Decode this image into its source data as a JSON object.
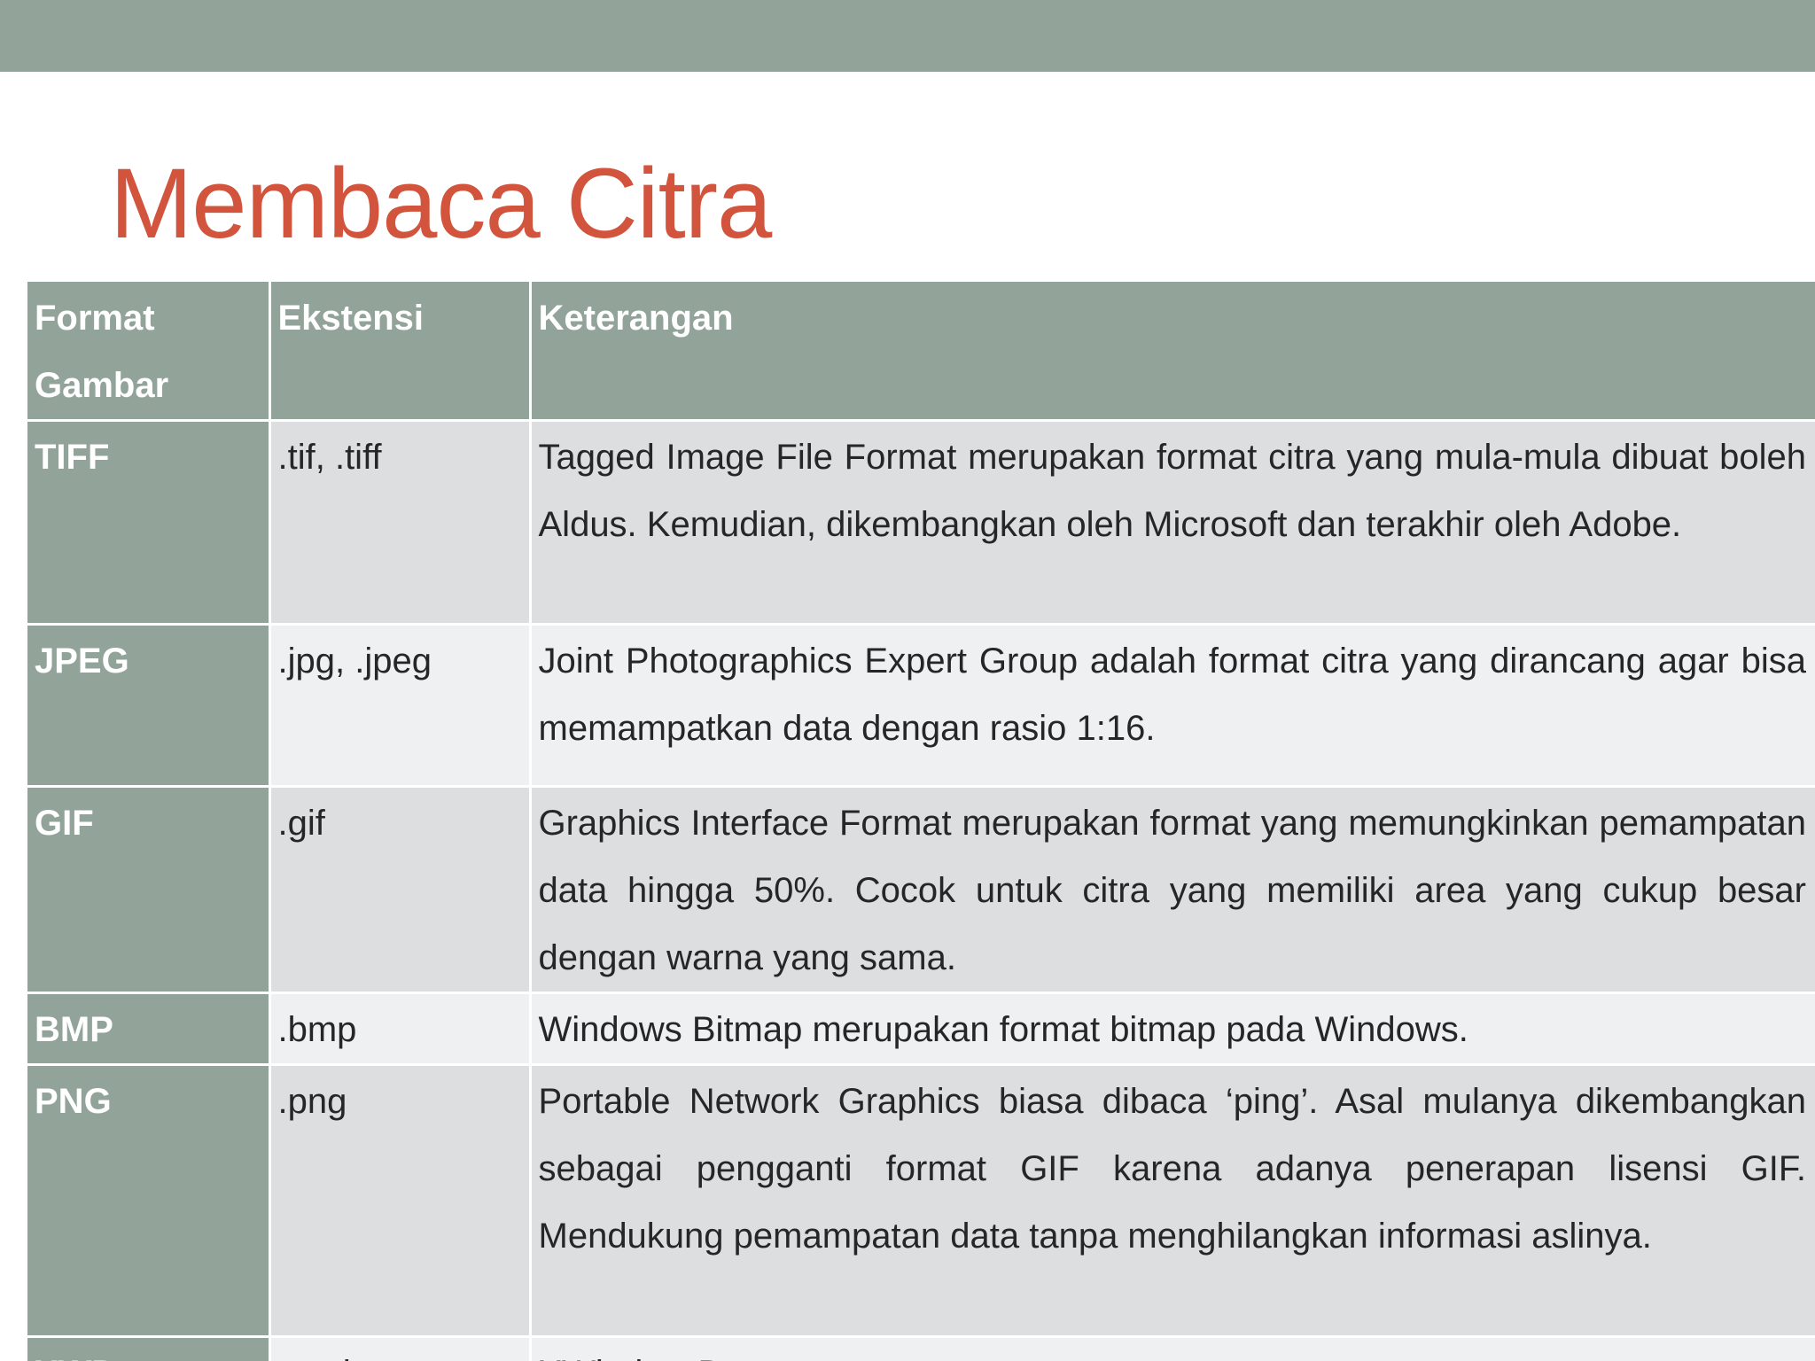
{
  "slide": {
    "title": "Membaca Citra"
  },
  "table": {
    "headers": {
      "format": "Format Gambar",
      "ext": "Ekstensi",
      "desc": "Keterangan"
    },
    "rows": [
      {
        "format": "TIFF",
        "ext": ".tif, .tiff",
        "desc": "Tagged Image File Format merupakan format citra yang mula-mula dibuat boleh Aldus. Kemudian, dikembangkan oleh Microsoft dan terakhir oleh Adobe."
      },
      {
        "format": "JPEG",
        "ext": ".jpg, .jpeg",
        "desc": "Joint Photographics Expert Group adalah format citra yang dirancang agar bisa memampatkan data dengan rasio 1:16."
      },
      {
        "format": "GIF",
        "ext": ".gif",
        "desc": "Graphics Interface Format merupakan format yang memungkinkan pemampatan data hingga 50%. Cocok untuk citra yang memiliki area yang cukup besar dengan warna yang sama."
      },
      {
        "format": "BMP",
        "ext": ".bmp",
        "desc": "Windows Bitmap merupakan format bitmap pada Windows."
      },
      {
        "format": "PNG",
        "ext": ".png",
        "desc": "Portable Network Graphics biasa dibaca ‘ping’. Asal mulanya dikembangkan sebagai pengganti format GIF karena adanya penerapan lisensi GIF. Mendukung pemampatan data tanpa menghilangkan informasi aslinya."
      },
      {
        "format": "XWD",
        "ext": ".xwd",
        "desc": "XWindow Dump"
      }
    ]
  },
  "colors": {
    "header_bar": "#92a39a",
    "title": "#d2543d",
    "row_odd": "#dcdedf",
    "row_even": "#eff0f1",
    "body_text": "#262626"
  }
}
